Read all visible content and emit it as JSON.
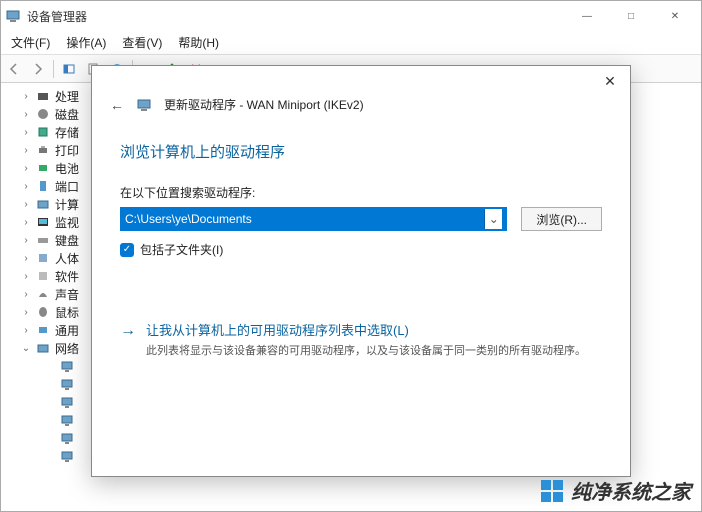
{
  "window": {
    "title": "设备管理器",
    "minimize": "—",
    "maximize": "□",
    "close": "✕"
  },
  "menu": {
    "file": "文件(F)",
    "action": "操作(A)",
    "view": "查看(V)",
    "help": "帮助(H)"
  },
  "tree": {
    "items": [
      {
        "exp": ">",
        "label": "处理"
      },
      {
        "exp": ">",
        "label": "磁盘"
      },
      {
        "exp": ">",
        "label": "存储"
      },
      {
        "exp": ">",
        "label": "打印"
      },
      {
        "exp": ">",
        "label": "电池"
      },
      {
        "exp": ">",
        "label": "端口"
      },
      {
        "exp": ">",
        "label": "计算"
      },
      {
        "exp": ">",
        "label": "监视"
      },
      {
        "exp": ">",
        "label": "键盘"
      },
      {
        "exp": ">",
        "label": "人体"
      },
      {
        "exp": ">",
        "label": "软件"
      },
      {
        "exp": ">",
        "label": "声音"
      },
      {
        "exp": ">",
        "label": "鼠标"
      },
      {
        "exp": ">",
        "label": "通用"
      },
      {
        "exp": "v",
        "label": "网络"
      }
    ]
  },
  "dialog": {
    "header": "更新驱动程序 - WAN Miniport (IKEv2)",
    "title": "浏览计算机上的驱动程序",
    "search_label": "在以下位置搜索驱动程序:",
    "path": "C:\\Users\\ye\\Documents",
    "browse": "浏览(R)...",
    "include_sub": "包括子文件夹(I)",
    "pick_title": "让我从计算机上的可用驱动程序列表中选取(L)",
    "pick_desc": "此列表将显示与该设备兼容的可用驱动程序，以及与该设备属于同一类别的所有驱动程序。"
  },
  "watermark": {
    "text": "纯净系统之家"
  }
}
